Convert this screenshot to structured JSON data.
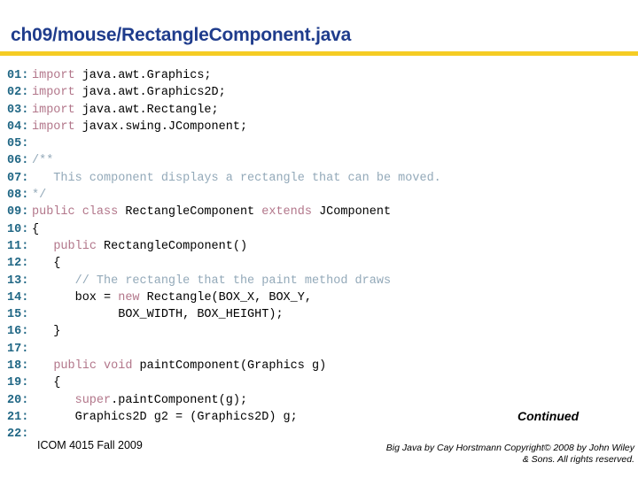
{
  "slide": {
    "title": "ch09/mouse/RectangleComponent.java",
    "title_color": "#1F3C8C",
    "rule_color": "#F5CC24",
    "continued_label": "Continued"
  },
  "theme": {
    "lineno_color": "#1F6684",
    "keyword_color": "#B2768A",
    "comment_color": "#93A9B9",
    "text_color": "#000000",
    "background": "#FFFFFF"
  },
  "code": {
    "language": "java",
    "lines": [
      {
        "no": "01:",
        "tokens": [
          {
            "t": "kw",
            "s": "import"
          },
          {
            "t": "txt",
            "s": " java.awt.Graphics;"
          }
        ]
      },
      {
        "no": "02:",
        "tokens": [
          {
            "t": "kw",
            "s": "import"
          },
          {
            "t": "txt",
            "s": " java.awt.Graphics2D;"
          }
        ]
      },
      {
        "no": "03:",
        "tokens": [
          {
            "t": "kw",
            "s": "import"
          },
          {
            "t": "txt",
            "s": " java.awt.Rectangle;"
          }
        ]
      },
      {
        "no": "04:",
        "tokens": [
          {
            "t": "kw",
            "s": "import"
          },
          {
            "t": "txt",
            "s": " javax.swing.JComponent;"
          }
        ]
      },
      {
        "no": "05:",
        "tokens": []
      },
      {
        "no": "06:",
        "tokens": [
          {
            "t": "cmt",
            "s": "/**"
          }
        ]
      },
      {
        "no": "07:",
        "tokens": [
          {
            "t": "cmt",
            "s": "   This component displays a rectangle that can be moved."
          }
        ]
      },
      {
        "no": "08:",
        "tokens": [
          {
            "t": "cmt",
            "s": "*/"
          }
        ]
      },
      {
        "no": "09:",
        "tokens": [
          {
            "t": "kw",
            "s": "public class"
          },
          {
            "t": "txt",
            "s": " RectangleComponent "
          },
          {
            "t": "kw",
            "s": "extends"
          },
          {
            "t": "txt",
            "s": " JComponent"
          }
        ]
      },
      {
        "no": "10:",
        "tokens": [
          {
            "t": "txt",
            "s": "{"
          }
        ]
      },
      {
        "no": "11:",
        "tokens": [
          {
            "t": "txt",
            "s": "   "
          },
          {
            "t": "kw",
            "s": "public"
          },
          {
            "t": "txt",
            "s": " RectangleComponent()"
          }
        ]
      },
      {
        "no": "12:",
        "tokens": [
          {
            "t": "txt",
            "s": "   {"
          }
        ]
      },
      {
        "no": "13:",
        "tokens": [
          {
            "t": "txt",
            "s": "      "
          },
          {
            "t": "cmt",
            "s": "// The rectangle that the paint method draws"
          }
        ]
      },
      {
        "no": "14:",
        "tokens": [
          {
            "t": "txt",
            "s": "      box = "
          },
          {
            "t": "kw",
            "s": "new"
          },
          {
            "t": "txt",
            "s": " Rectangle(BOX_X, BOX_Y,"
          }
        ]
      },
      {
        "no": "15:",
        "tokens": [
          {
            "t": "txt",
            "s": "            BOX_WIDTH, BOX_HEIGHT);"
          }
        ]
      },
      {
        "no": "16:",
        "tokens": [
          {
            "t": "txt",
            "s": "   }"
          }
        ]
      },
      {
        "no": "17:",
        "tokens": []
      },
      {
        "no": "18:",
        "tokens": [
          {
            "t": "txt",
            "s": "   "
          },
          {
            "t": "kw",
            "s": "public void"
          },
          {
            "t": "txt",
            "s": " paintComponent(Graphics g)"
          }
        ]
      },
      {
        "no": "19:",
        "tokens": [
          {
            "t": "txt",
            "s": "   {"
          }
        ]
      },
      {
        "no": "20:",
        "tokens": [
          {
            "t": "txt",
            "s": "      "
          },
          {
            "t": "kw",
            "s": "super"
          },
          {
            "t": "txt",
            "s": ".paintComponent(g);"
          }
        ]
      },
      {
        "no": "21:",
        "tokens": [
          {
            "t": "txt",
            "s": "      Graphics2D g2 = (Graphics2D) g;"
          }
        ]
      },
      {
        "no": "22:",
        "tokens": []
      }
    ]
  },
  "footer": {
    "course": "ICOM 4015 Fall 2009",
    "copyright_line1": "Big Java by Cay Horstmann Copyright© 2008 by John Wiley",
    "copyright_line2": "& Sons.  All rights reserved."
  }
}
